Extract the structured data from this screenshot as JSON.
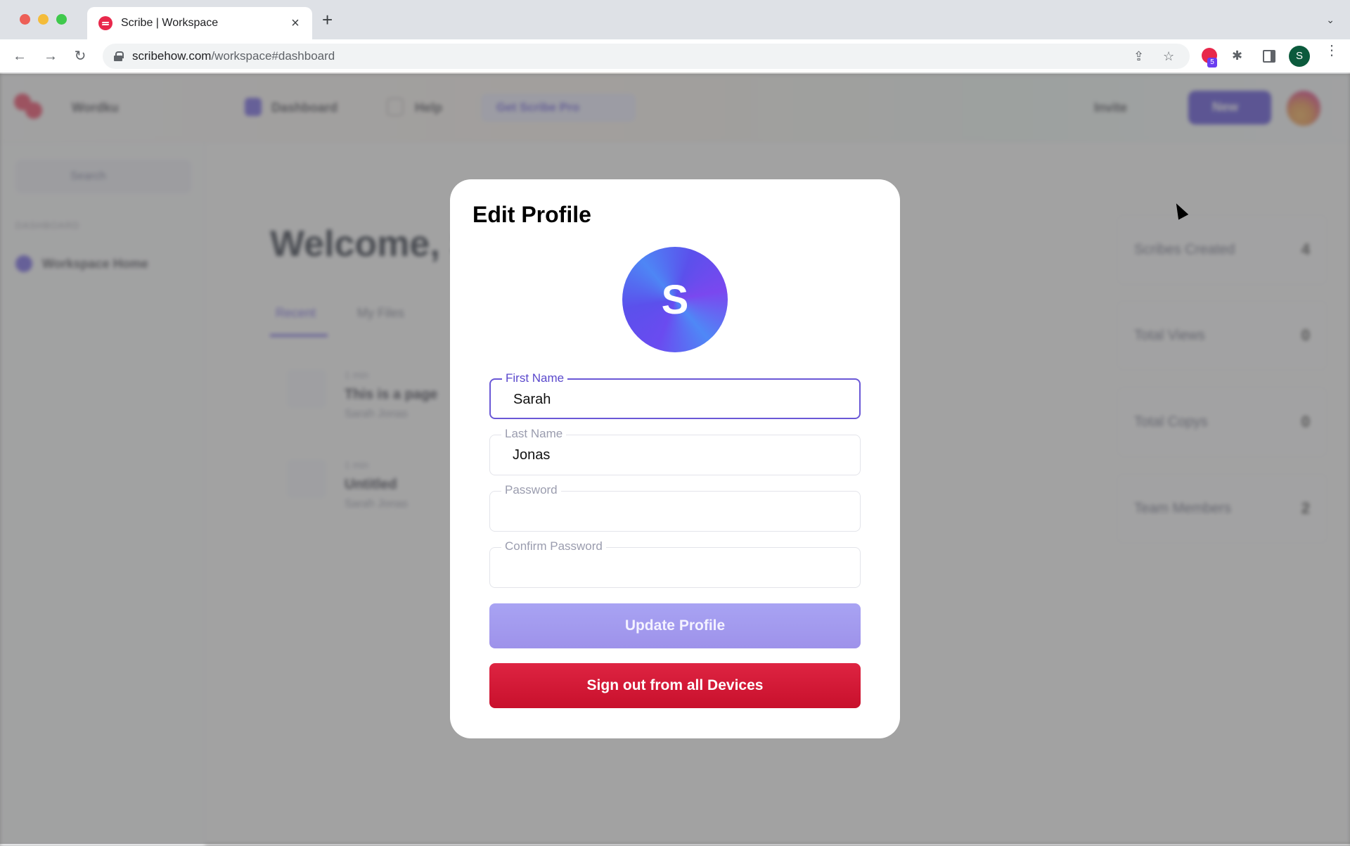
{
  "browser": {
    "tab_title": "Scribe | Workspace",
    "tab_close_icon": "close-icon",
    "new_tab_icon": "plus-icon",
    "url_domain": "scribehow.com",
    "url_path": "/workspace#dashboard",
    "extension_badge": "5",
    "profile_initial": "S",
    "icons": {
      "back": "←",
      "forward": "→",
      "reload": "↻",
      "share": "⇪",
      "bookmark": "☆",
      "extensions": "✱",
      "menu": "⋮",
      "tab_search": "⌄"
    }
  },
  "background_app": {
    "workspace_label": "Wordku",
    "nav": [
      {
        "label": "Dashboard"
      },
      {
        "label": "Help"
      }
    ],
    "pro_button": "Get Scribe Pro",
    "invite_label": "Invite",
    "new_button": "New",
    "sidebar": {
      "search_label": "Search",
      "section_label": "DASHBOARD",
      "items": [
        {
          "label": "Workspace Home"
        }
      ]
    },
    "welcome": "Welcome, Sarah",
    "tabs": [
      {
        "label": "Recent",
        "active": true
      },
      {
        "label": "My Files",
        "active": false
      }
    ],
    "files": [
      {
        "meta": "1 min",
        "title": "This is a page",
        "author": "Sarah Jonas"
      },
      {
        "meta": "1 min",
        "title": "Untitled",
        "author": "Sarah Jonas"
      }
    ],
    "stats": [
      {
        "label": "Scribes Created",
        "value": "4"
      },
      {
        "label": "Total Views",
        "value": "0"
      },
      {
        "label": "Total Copys",
        "value": "0"
      },
      {
        "label": "Team Members",
        "value": "2"
      }
    ]
  },
  "modal": {
    "title": "Edit Profile",
    "avatar_initial": "S",
    "fields": [
      {
        "label": "First Name",
        "value": "Sarah",
        "focused": true
      },
      {
        "label": "Last Name",
        "value": "Jonas",
        "focused": false
      },
      {
        "label": "Password",
        "value": "",
        "focused": false
      },
      {
        "label": "Confirm Password",
        "value": "",
        "focused": false
      }
    ],
    "update_button": "Update Profile",
    "signout_button": "Sign out from all Devices"
  },
  "colors": {
    "accent": "#5a48cc",
    "update_button": "#a39bef",
    "danger": "#d01a35",
    "brand_scribe": "#e8284b"
  }
}
